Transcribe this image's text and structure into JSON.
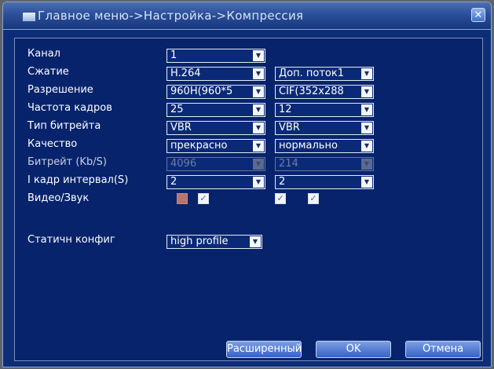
{
  "window": {
    "title": "Главное меню->Настройка->Компрессия",
    "close_glyph": "✕"
  },
  "labels": {
    "channel": "Канал",
    "compression": "Сжатие",
    "resolution": "Разрешение",
    "frame_rate": "Частота кадров",
    "bitrate_type": "Тип битрейта",
    "quality": "Качество",
    "bitrate": "Битрейт (Kb/S)",
    "iframe_interval": "I кадр интервал(S)",
    "video_audio": "Видео/Звук",
    "static_config": "Статичн конфиг"
  },
  "main_stream": {
    "channel": "1",
    "compression": "H.264",
    "resolution": "960H(960*5",
    "frame_rate": "25",
    "bitrate_type": "VBR",
    "quality": "прекрасно",
    "bitrate": "4096",
    "iframe_interval": "2",
    "video_checked": true,
    "audio_checked": true,
    "static_config": "high profile"
  },
  "extra_stream": {
    "compression": "Доп. поток1",
    "resolution": "CIF(352x288",
    "frame_rate": "12",
    "bitrate_type": "VBR",
    "quality": "нормально",
    "bitrate": "214",
    "iframe_interval": "2",
    "video_checked": true,
    "audio_checked": true
  },
  "buttons": {
    "advanced": "Расширенный",
    "ok": "OK",
    "cancel": "Отмена"
  },
  "icons": {
    "dropdown": "▼",
    "check": "✓"
  }
}
